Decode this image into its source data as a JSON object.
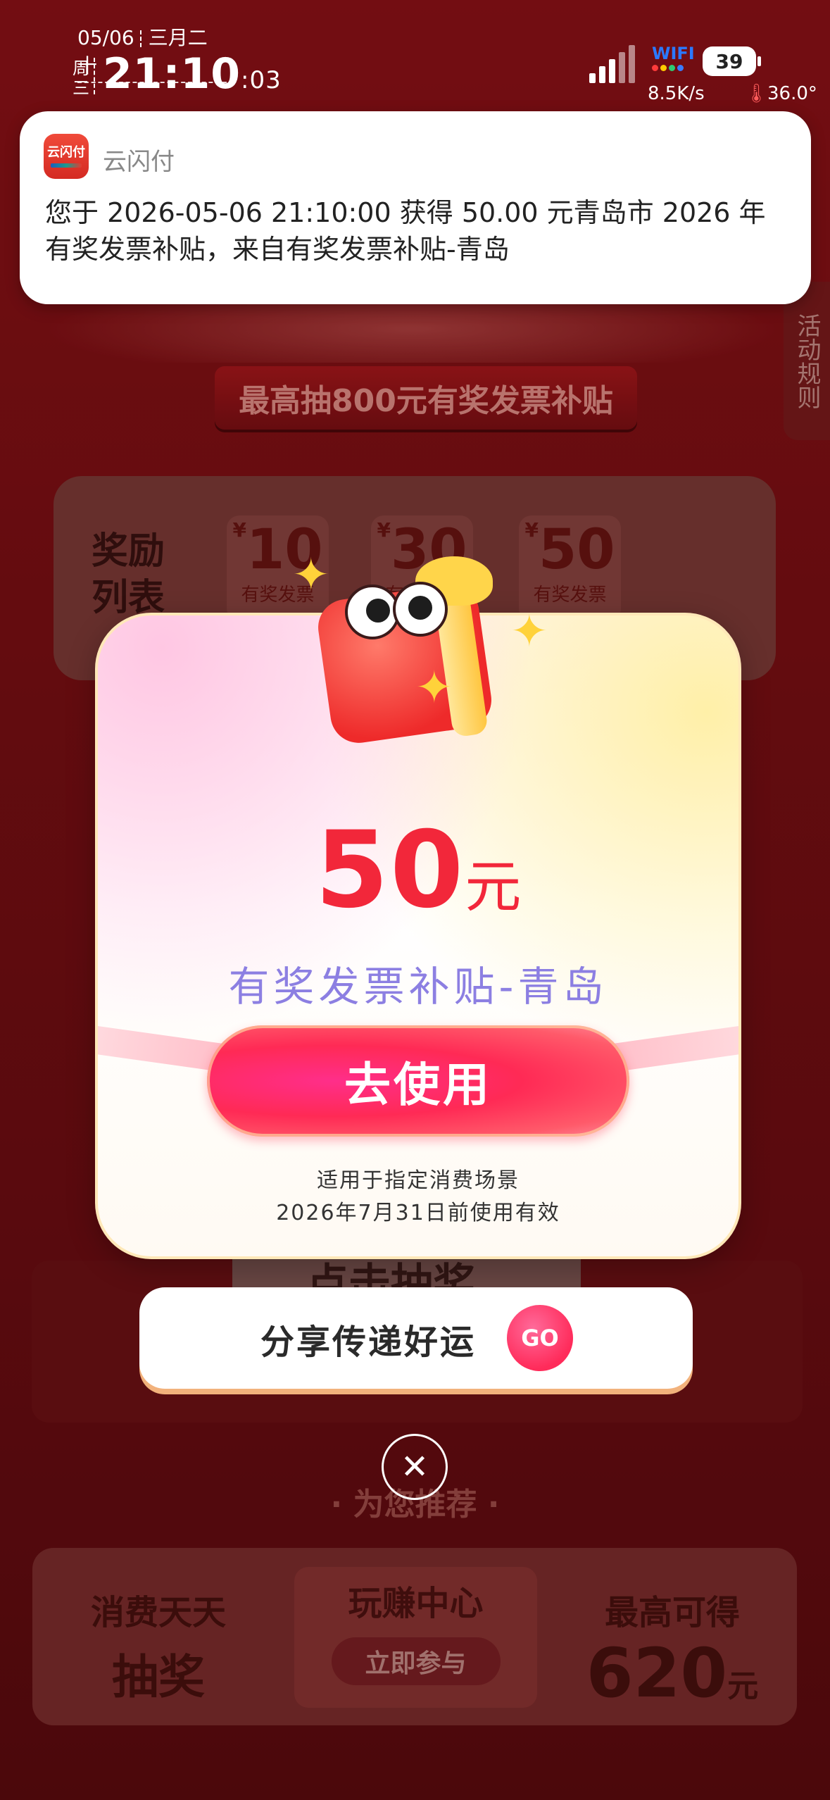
{
  "status_bar": {
    "date": "05/06",
    "lunar_date": "三月二十",
    "weekday": "周三",
    "time_hm": "21:10",
    "time_sec": ":03",
    "wifi_label": "WIFI",
    "battery": "39",
    "net_speed": "8.5K/s",
    "temperature": "36.0°"
  },
  "notification": {
    "app_name": "云闪付",
    "icon_text": "云闪付",
    "message": "您于 2026-05-06 21:10:00 获得 50.00 元青岛市 2026 年有奖发票补贴，来自有奖发票补贴-青岛"
  },
  "background": {
    "subtitle_banner": "最高抽800元有奖发票补贴",
    "side_rules": "活动规则",
    "reward_label": "奖励列表",
    "reward_cards": [
      {
        "currency": "¥",
        "amount": "10",
        "label": "有奖发票"
      },
      {
        "currency": "¥",
        "amount": "30",
        "label": "有奖发票"
      },
      {
        "currency": "¥",
        "amount": "50",
        "label": "有奖发票"
      }
    ],
    "machine_button": "点击抽奖",
    "recommend": "· 为您推荐 ·",
    "promo_left_line1": "消费天天",
    "promo_left_line2": "抽奖",
    "promo_center_title": "玩赚中心",
    "promo_center_button": "立即参与",
    "promo_right_line1": "最高可得",
    "promo_right_amount": "620",
    "promo_right_unit": "元"
  },
  "modal": {
    "amount": "50",
    "unit": "元",
    "subsidy_name": "有奖发票补贴-青岛",
    "use_button": "去使用",
    "note_line1": "适用于指定消费场景",
    "note_line2": "2026年7月31日前使用有效"
  },
  "share": {
    "label": "分享传递好运",
    "go_label": "GO"
  },
  "colors": {
    "accent_red": "#f2273a",
    "subsidy_purple": "#8c7fe2",
    "button_pink": "#ff2a55"
  }
}
